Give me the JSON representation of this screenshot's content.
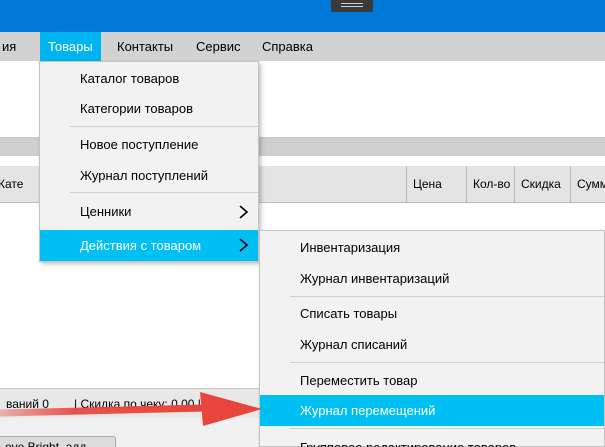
{
  "menubar": {
    "items": [
      {
        "label": "ия"
      },
      {
        "label": "Товары"
      },
      {
        "label": "Контакты"
      },
      {
        "label": "Сервис"
      },
      {
        "label": "Справка"
      }
    ]
  },
  "table": {
    "columns": [
      "Кате",
      "Цена",
      "Кол-во",
      "Скидка",
      "Сумм"
    ]
  },
  "status_bar": {
    "items_text": "ваний  0",
    "discount_text": "|  Скидка по чеку:  0,00  |"
  },
  "bottom": {
    "button_label": "ove Bright, адд"
  },
  "goods_menu": {
    "items": [
      {
        "label": "Каталог товаров"
      },
      {
        "label": "Категории товаров"
      },
      {
        "label": "Новое поступление"
      },
      {
        "label": "Журнал поступлений"
      },
      {
        "label": "Ценники"
      },
      {
        "label": "Действия с товаром"
      }
    ]
  },
  "actions_menu": {
    "items": [
      {
        "label": "Инвентаризация"
      },
      {
        "label": "Журнал инвентаризаций"
      },
      {
        "label": "Списать товары"
      },
      {
        "label": "Журнал списаний"
      },
      {
        "label": "Переместить товар"
      },
      {
        "label": "Журнал перемещений"
      },
      {
        "label": "Групповое редактирование товаров"
      }
    ]
  },
  "colors": {
    "titlebar": "#0078d7",
    "highlight": "#00bff3",
    "annotation_arrow": "#e8453c"
  }
}
